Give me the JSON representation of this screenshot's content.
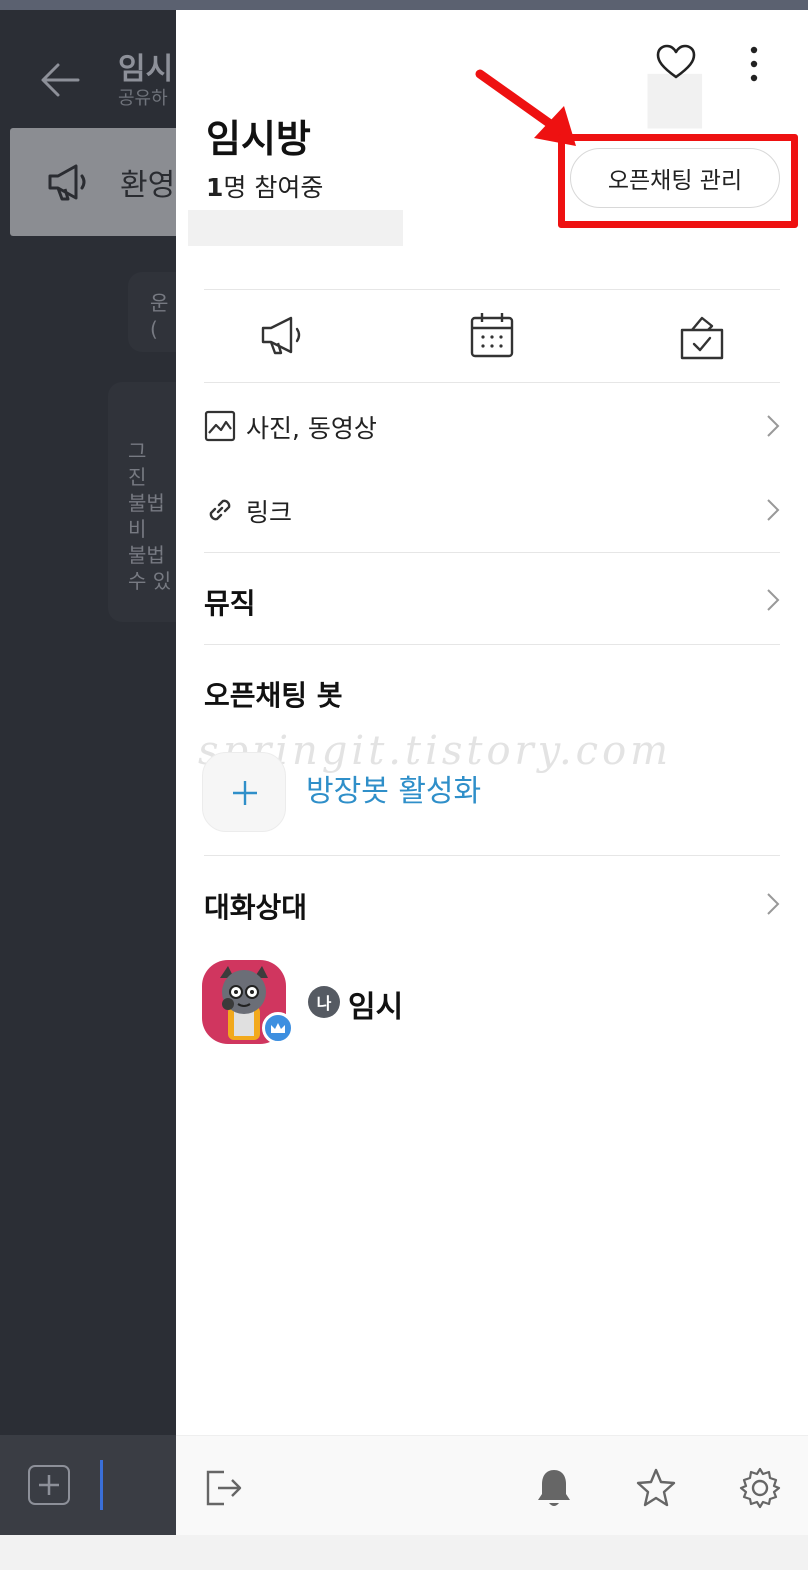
{
  "background_chat": {
    "title": "임시",
    "subtitle": "공유하",
    "notice_text": "환영",
    "card1_lines": [
      "운",
      "("
    ],
    "card2_lines": [
      "그",
      "진",
      "불법",
      "비",
      "불법",
      "수 있"
    ]
  },
  "drawer": {
    "room_title": "임시방",
    "member_count": "1",
    "member_count_suffix": "명 참여중",
    "manage_button": "오픈채팅 관리",
    "quick_tools": [
      {
        "icon": "megaphone-icon"
      },
      {
        "icon": "calendar-icon"
      },
      {
        "icon": "vote-icon"
      }
    ],
    "menu": {
      "photos_label": "사진, 동영상",
      "links_label": "링크",
      "music_label": "뮤직"
    },
    "bot_section": {
      "title": "오픈채팅 봇",
      "activate_label": "방장봇 활성화"
    },
    "members_section": {
      "title": "대화상대",
      "me_badge": "나",
      "member_name": "임시"
    },
    "watermark": "springit.tistory.com"
  },
  "colors": {
    "highlight_red": "#ee1111",
    "bot_link_blue": "#2f8fc9",
    "crown_blue": "#3d8fe0",
    "avatar_pink": "#d0365f"
  }
}
